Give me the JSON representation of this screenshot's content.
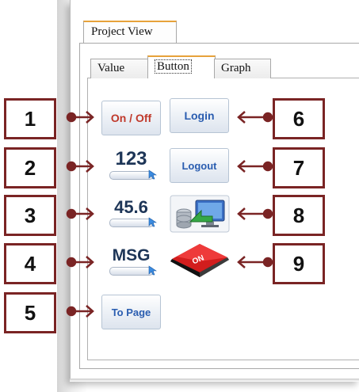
{
  "window": {
    "tab_title": "Project View"
  },
  "tabs": [
    {
      "label": "Value",
      "active": false
    },
    {
      "label": "Button",
      "active": true
    },
    {
      "label": "Graph",
      "active": false
    }
  ],
  "buttons": {
    "on_off": "On / Off",
    "login": "Login",
    "num_int": "123",
    "logout": "Logout",
    "num_float": "45.6",
    "msg": "MSG",
    "to_page": "To Page",
    "toggle_on_text": "ON"
  },
  "labels": [
    "1",
    "2",
    "3",
    "4",
    "5",
    "6",
    "7",
    "8",
    "9"
  ],
  "colors": {
    "label_border": "#7a2424",
    "arrow": "#7a2424",
    "tab_accent": "#e7a23a",
    "button_red": "#c0392b",
    "button_blue": "#2a5db0"
  },
  "icons": {
    "backup": "database-monitor-icon",
    "toggle": "red-on-toggle-icon",
    "numeric_pointer": "cursor-arrow-icon"
  }
}
